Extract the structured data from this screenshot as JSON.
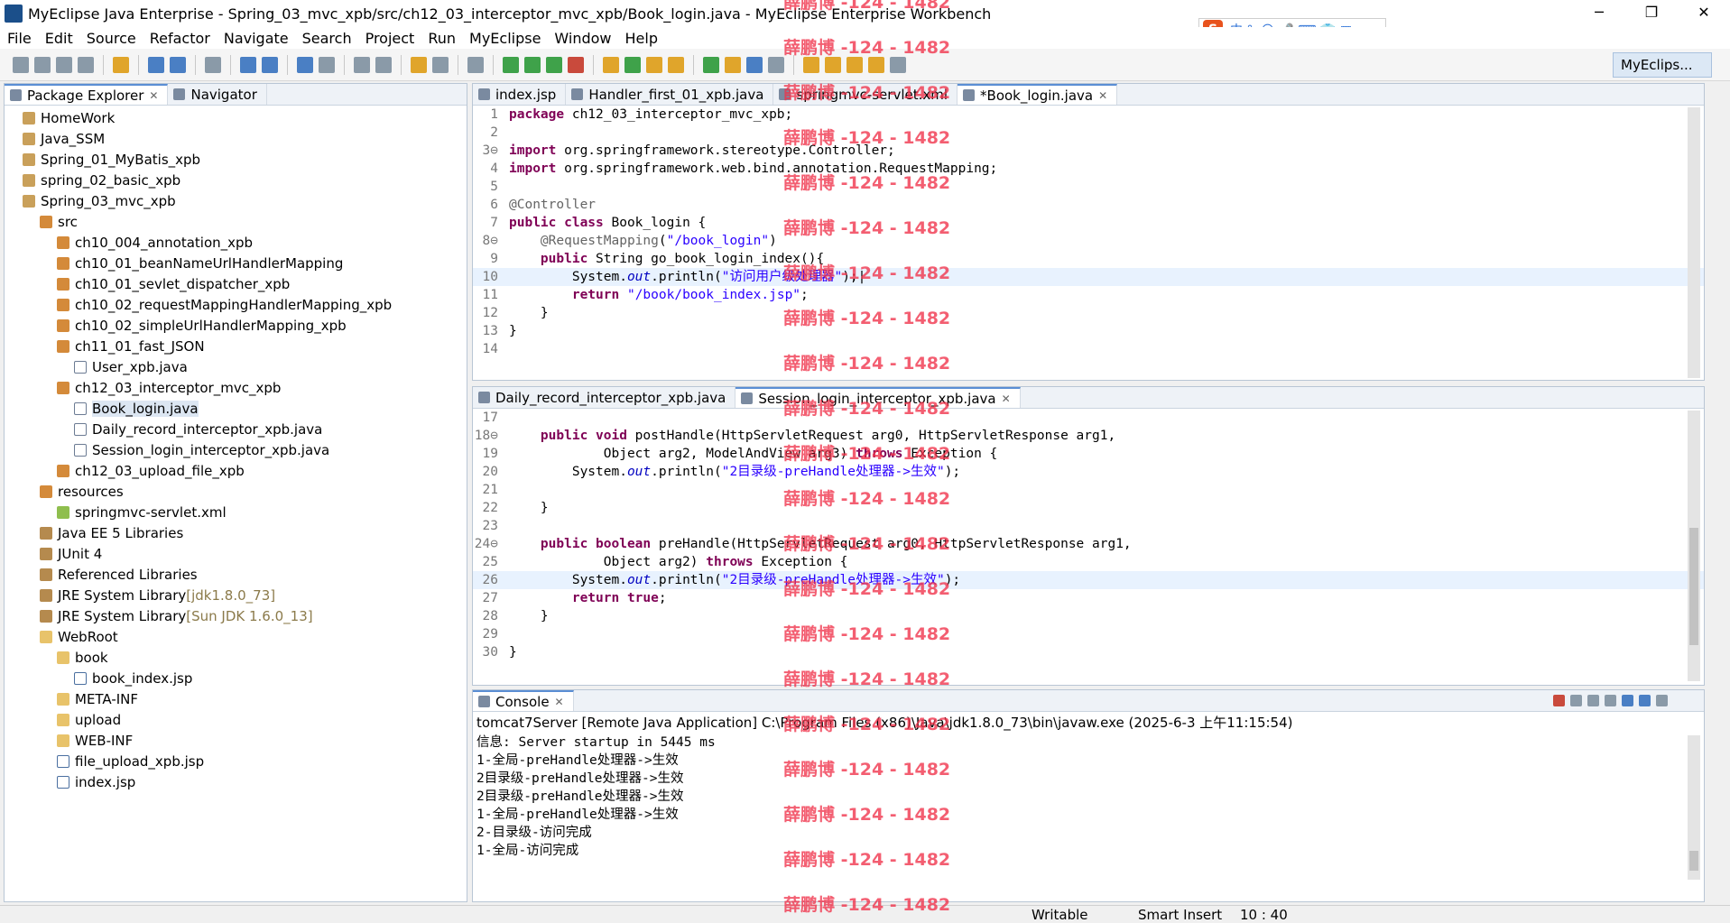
{
  "window": {
    "title": "MyEclipse Java Enterprise - Spring_03_mvc_xpb/src/ch12_03_interceptor_mvc_xpb/Book_login.java - MyEclipse Enterprise Workbench",
    "minimize": "─",
    "maximize": "❐",
    "close": "✕"
  },
  "ime": {
    "logo": "S",
    "text": "中 °, ☺ 🎤 ⌨ 👕 ▦"
  },
  "menu": [
    "File",
    "Edit",
    "Source",
    "Refactor",
    "Navigate",
    "Search",
    "Project",
    "Run",
    "MyEclipse",
    "Window",
    "Help"
  ],
  "perspective": "MyEclips...",
  "package_explorer": {
    "tabs": [
      "Package Explorer",
      "Navigator"
    ],
    "items": [
      {
        "label": "HomeWork",
        "indent": 0,
        "icon": "proj"
      },
      {
        "label": "Java_SSM",
        "indent": 0,
        "icon": "proj"
      },
      {
        "label": "Spring_01_MyBatis_xpb",
        "indent": 0,
        "icon": "proj"
      },
      {
        "label": "spring_02_basic_xpb",
        "indent": 0,
        "icon": "proj"
      },
      {
        "label": "Spring_03_mvc_xpb",
        "indent": 0,
        "icon": "proj"
      },
      {
        "label": "src",
        "indent": 1,
        "icon": "pkg"
      },
      {
        "label": "ch10_004_annotation_xpb",
        "indent": 2,
        "icon": "pkg"
      },
      {
        "label": "ch10_01_beanNameUrlHandlerMapping",
        "indent": 2,
        "icon": "pkg"
      },
      {
        "label": "ch10_01_sevlet_dispatcher_xpb",
        "indent": 2,
        "icon": "pkg"
      },
      {
        "label": "ch10_02_requestMappingHandlerMapping_xpb",
        "indent": 2,
        "icon": "pkg"
      },
      {
        "label": "ch10_02_simpleUrlHandlerMapping_xpb",
        "indent": 2,
        "icon": "pkg"
      },
      {
        "label": "ch11_01_fast_JSON",
        "indent": 2,
        "icon": "pkg"
      },
      {
        "label": "User_xpb.java",
        "indent": 3,
        "icon": "file"
      },
      {
        "label": "ch12_03_interceptor_mvc_xpb",
        "indent": 2,
        "icon": "pkg"
      },
      {
        "label": "Book_login.java",
        "indent": 3,
        "icon": "file",
        "selected": true
      },
      {
        "label": "Daily_record_interceptor_xpb.java",
        "indent": 3,
        "icon": "file"
      },
      {
        "label": "Session_login_interceptor_xpb.java",
        "indent": 3,
        "icon": "file"
      },
      {
        "label": "ch12_03_upload_file_xpb",
        "indent": 2,
        "icon": "pkg"
      },
      {
        "label": "resources",
        "indent": 1,
        "icon": "pkg"
      },
      {
        "label": "springmvc-servlet.xml",
        "indent": 2,
        "icon": "xml"
      },
      {
        "label": "Java EE 5 Libraries",
        "indent": 1,
        "icon": "lib"
      },
      {
        "label": "JUnit 4",
        "indent": 1,
        "icon": "lib"
      },
      {
        "label": "Referenced Libraries",
        "indent": 1,
        "icon": "lib"
      },
      {
        "label": "JRE System Library",
        "suffix": "[jdk1.8.0_73]",
        "indent": 1,
        "icon": "lib"
      },
      {
        "label": "JRE System Library",
        "suffix": "[Sun JDK 1.6.0_13]",
        "indent": 1,
        "icon": "lib"
      },
      {
        "label": "WebRoot",
        "indent": 1,
        "icon": "folder"
      },
      {
        "label": "book",
        "indent": 2,
        "icon": "folder"
      },
      {
        "label": "book_index.jsp",
        "indent": 3,
        "icon": "jsp"
      },
      {
        "label": "META-INF",
        "indent": 2,
        "icon": "folder"
      },
      {
        "label": "upload",
        "indent": 2,
        "icon": "folder"
      },
      {
        "label": "WEB-INF",
        "indent": 2,
        "icon": "folder"
      },
      {
        "label": "file_upload_xpb.jsp",
        "indent": 2,
        "icon": "jsp"
      },
      {
        "label": "index.jsp",
        "indent": 2,
        "icon": "jsp"
      }
    ]
  },
  "editor_top": {
    "tabs": [
      {
        "label": "index.jsp",
        "active": false
      },
      {
        "label": "Handler_first_01_xpb.java",
        "active": false
      },
      {
        "label": "springmvc-servlet.xml",
        "active": false
      },
      {
        "label": "*Book_login.java",
        "active": true
      }
    ],
    "lines": [
      {
        "n": "1",
        "html": "<span class=\"kw\">package</span> ch12_03_interceptor_mvc_xpb;"
      },
      {
        "n": "2",
        "html": ""
      },
      {
        "n": "3⊖",
        "html": "<span class=\"kw\">import</span> org.springframework.stereotype.Controller;"
      },
      {
        "n": "4",
        "html": "<span class=\"kw\">import</span> org.springframework.web.bind.annotation.RequestMapping;"
      },
      {
        "n": "5",
        "html": ""
      },
      {
        "n": "6",
        "html": "<span class=\"ann\">@Controller</span>"
      },
      {
        "n": "7",
        "html": "<span class=\"kw\">public class</span> Book_login {"
      },
      {
        "n": "8⊖",
        "html": "    <span class=\"ann\">@RequestMapping</span>(<span class=\"str\">\"/book_login\"</span>)"
      },
      {
        "n": "9",
        "html": "    <span class=\"kw\">public</span> String go_book_login_index(){"
      },
      {
        "n": "10",
        "html": "        System.<span class=\"fld\">out</span>.println(<span class=\"str\">\"访问用户级处理器\"</span>);|",
        "hl": true
      },
      {
        "n": "11",
        "html": "        <span class=\"kw\">return</span> <span class=\"str\">\"/book/book_index.jsp\"</span>;"
      },
      {
        "n": "12",
        "html": "    }"
      },
      {
        "n": "13",
        "html": "}"
      },
      {
        "n": "14",
        "html": ""
      }
    ]
  },
  "editor_bottom": {
    "tabs": [
      {
        "label": "Daily_record_interceptor_xpb.java",
        "active": false
      },
      {
        "label": "Session_login_interceptor_xpb.java",
        "active": true
      }
    ],
    "lines": [
      {
        "n": "17",
        "html": ""
      },
      {
        "n": "18⊖",
        "html": "    <span class=\"kw\">public void</span> postHandle(HttpServletRequest arg0, HttpServletResponse arg1,"
      },
      {
        "n": "19",
        "html": "            Object arg2, ModelAndView arg3) <span class=\"kw\">throws</span> Exception {"
      },
      {
        "n": "20",
        "html": "        System.<span class=\"fld\">out</span>.println(<span class=\"str\">\"2目录级-preHandle处理器->生效\"</span>);"
      },
      {
        "n": "21",
        "html": ""
      },
      {
        "n": "22",
        "html": "    }"
      },
      {
        "n": "23",
        "html": ""
      },
      {
        "n": "24⊖",
        "html": "    <span class=\"kw\">public boolean</span> preHandle(HttpServletRequest arg0, HttpServletResponse arg1,"
      },
      {
        "n": "25",
        "html": "            Object arg2) <span class=\"kw\">throws</span> Exception {"
      },
      {
        "n": "26",
        "html": "        System.<span class=\"fld\">out</span>.println(<span class=\"str\">\"2目录级-preHandle处理器->生效\"</span>);",
        "hl": true
      },
      {
        "n": "27",
        "html": "        <span class=\"kw\">return true</span>;"
      },
      {
        "n": "28",
        "html": "    }"
      },
      {
        "n": "29",
        "html": ""
      },
      {
        "n": "30",
        "html": "}"
      }
    ]
  },
  "console": {
    "tab": "Console",
    "header": "tomcat7Server [Remote Java Application] C:\\Program Files (x86)\\Java\\jdk1.8.0_73\\bin\\javaw.exe (2025-6-3 上午11:15:54)",
    "lines": [
      "信息: Server startup in 5445 ms",
      "1-全局-preHandle处理器->生效",
      "2目录级-preHandle处理器->生效",
      "2目录级-preHandle处理器->生效",
      "1-全局-preHandle处理器->生效",
      "2-目录级-访问完成",
      "1-全局-访问完成"
    ]
  },
  "status": {
    "writable": "Writable",
    "mode": "Smart Insert",
    "position": "10 : 40"
  },
  "watermark": "薛鹏博 -124 - 1482",
  "colors": {
    "keyword": "#7f0055",
    "string": "#2a00ff",
    "watermark": "#f0324a",
    "selection": "#dce6f2"
  }
}
